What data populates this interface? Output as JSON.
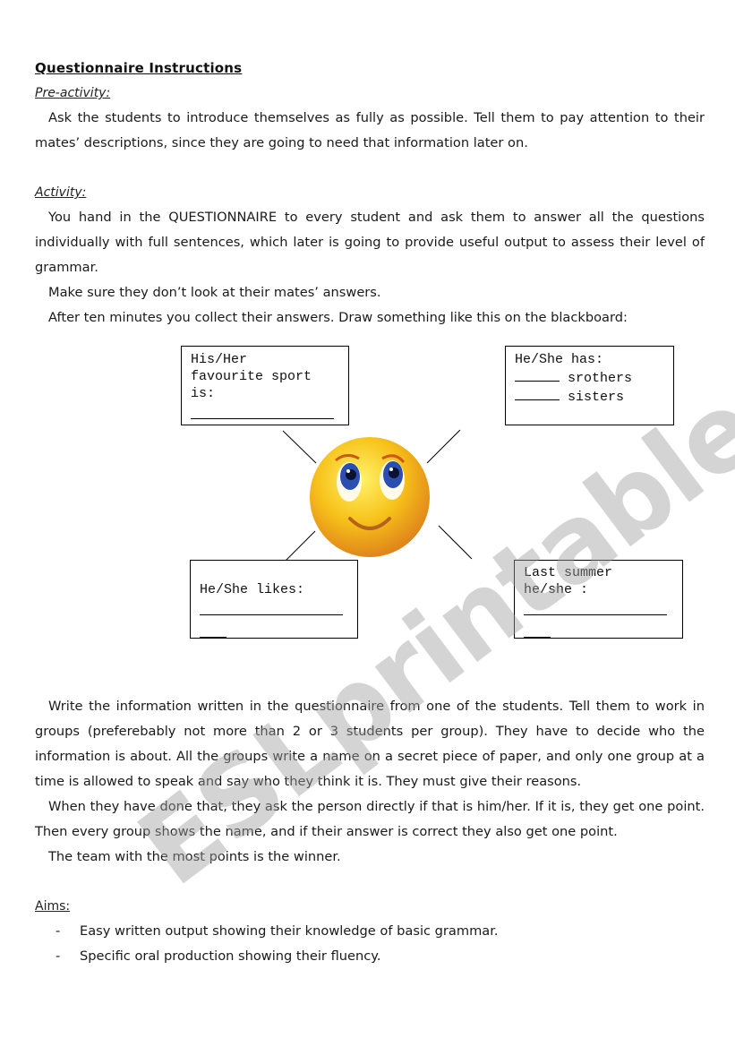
{
  "document": {
    "title": "Questionnaire Instructions",
    "sections": {
      "pre_activity": {
        "label": "Pre-activity:",
        "paragraphs": [
          "Ask the students to introduce themselves as fully as possible. Tell them to pay attention to their mates’ descriptions, since they are going to need that information later on."
        ]
      },
      "activity": {
        "label": "Activity:",
        "paragraphs": [
          "You hand in the QUESTIONNAIRE to every student and ask them to answer all the questions individually with full sentences, which later is going to provide useful output to assess their level of grammar.",
          "Make sure they don’t look at their mates’ answers.",
          "After ten minutes you collect their answers. Draw something like this on the blackboard:"
        ]
      },
      "after_diagram": {
        "paragraphs": [
          "Write the information written in the questionnaire from one of the students. Tell them to work in groups (preferebably not more than 2 or 3 students per group). They have to decide who the information is about. All the groups write a name on a secret piece of paper, and only one group at a time is allowed to speak and say who they think it is. They must give their reasons.",
          "When they have done that, they ask the person directly if that is him/her. If it is, they get one point. Then every group shows the name, and if their answer is correct they also get one point.",
          "The team with the most points is the winner."
        ]
      },
      "aims": {
        "label": "Aims:",
        "bullet": "-",
        "items": [
          "Easy written output showing their knowledge of basic grammar.",
          "Specific oral production showing their fluency."
        ]
      }
    },
    "diagram": {
      "center_icon": "smiley-face-icon",
      "boxes": {
        "top_left": {
          "lines": [
            "His/Her",
            "favourite sport",
            "is:"
          ]
        },
        "top_right": {
          "line1": "He/She has:",
          "line2": "srothers",
          "line3": "sisters"
        },
        "bottom_left": {
          "lines": [
            "He/She likes:"
          ]
        },
        "bottom_right": {
          "lines": [
            "Last summer",
            "he/she :"
          ]
        }
      }
    },
    "watermark": "ESLprintables.com",
    "colors": {
      "text": "#111111",
      "smiley_yellow": "#f7c21a",
      "smiley_orange": "#e8901a",
      "eye_blue": "#2a4fb0",
      "watermark": "#a0a0a0"
    }
  }
}
